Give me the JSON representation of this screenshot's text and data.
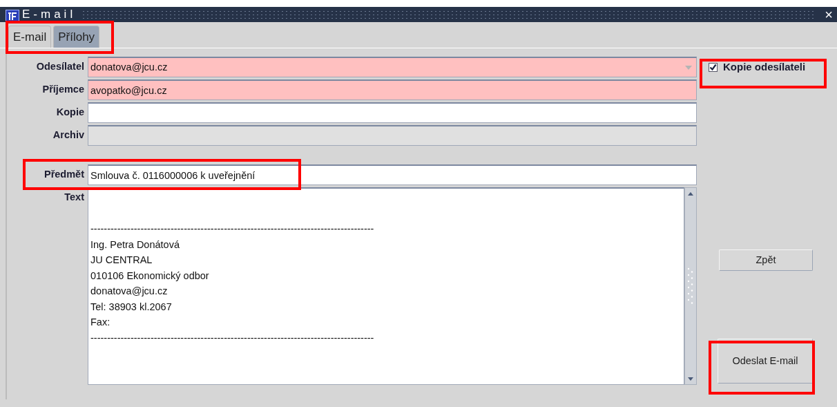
{
  "window": {
    "title": "E-mail",
    "close": "×"
  },
  "tabs": {
    "highlighted": true,
    "items": [
      {
        "label": "E-mail",
        "selected": true
      },
      {
        "label": "Přílohy",
        "selected": false
      }
    ]
  },
  "fields": [
    {
      "label": "Odesílatel",
      "kind": "dropdown",
      "value": "donatova@jcu.cz",
      "required": true,
      "disabled": false
    },
    {
      "label": "Příjemce",
      "kind": "text",
      "value": "avopatko@jcu.cz",
      "required": true,
      "disabled": false
    },
    {
      "label": "Kopie",
      "kind": "text",
      "required": false,
      "disabled": false
    },
    {
      "label": "Archiv",
      "kind": "text",
      "required": false,
      "disabled": true
    },
    {
      "label": "Předmět",
      "kind": "text",
      "value": "Smlouva č. 0116000006 k uveřejnění",
      "required": false,
      "disabled": false,
      "highlighted": true,
      "gap_before": true
    }
  ],
  "message": {
    "label": "Text",
    "text": "\n\n-------------------------------------------------------------------------------------\nIng. Petra Donátová\nJU CENTRAL\n010106 Ekonomický odbor\ndonatova@jcu.cz\nTel: 38903 kl.2067\nFax:\n-------------------------------------------------------------------------------------"
  },
  "copy_to_sender": {
    "label": "Kopie odesílateli",
    "checked": true,
    "highlighted": true
  },
  "buttons": [
    {
      "label": "Zpět",
      "highlighted": false,
      "kind": "small"
    },
    {
      "label": "Odeslat E-mail",
      "highlighted": true,
      "kind": "large"
    }
  ]
}
